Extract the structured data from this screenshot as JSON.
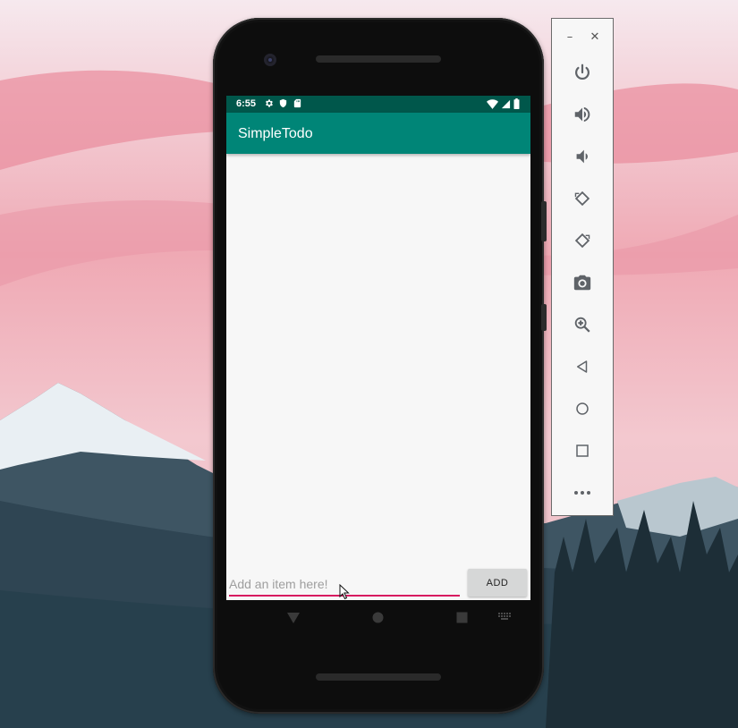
{
  "status_bar": {
    "time": "6:55",
    "left_icons": [
      "gear-icon",
      "shield-icon",
      "sd-card-icon"
    ],
    "right_icons": [
      "wifi-icon",
      "signal-icon",
      "battery-icon"
    ],
    "color": "#00574b"
  },
  "app": {
    "title": "SimpleTodo",
    "primary_color": "#008577",
    "accent_color": "#d81b60",
    "items": []
  },
  "input": {
    "placeholder": "Add an item here!",
    "value": ""
  },
  "add_button": {
    "label": "ADD"
  },
  "nav_bar": [
    "back-icon",
    "home-icon",
    "recents-icon",
    "keyboard-icon"
  ],
  "emulator_toolbar": {
    "window_controls": [
      "minimize-icon",
      "close-icon"
    ],
    "buttons": [
      "power-icon",
      "volume-up-icon",
      "volume-down-icon",
      "rotate-left-icon",
      "rotate-right-icon",
      "camera-icon",
      "zoom-icon",
      "back-icon",
      "home-icon",
      "overview-icon",
      "more-icon"
    ]
  }
}
